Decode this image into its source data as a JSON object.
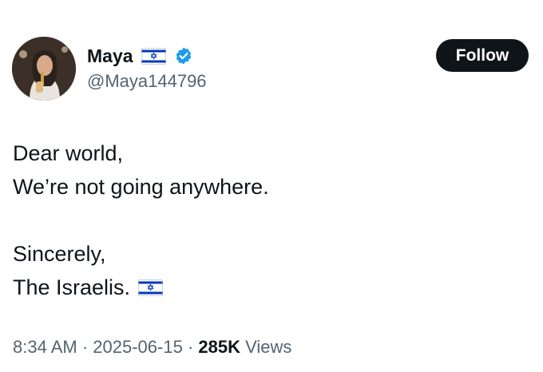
{
  "author": {
    "display_name": "Maya",
    "handle": "@Maya144796",
    "flag_icon": "israel-flag-icon",
    "verified_icon": "verified-badge-icon",
    "verified_color": "#1d9bf0"
  },
  "follow_button": {
    "label": "Follow"
  },
  "tweet": {
    "lines": [
      "Dear world,",
      "We’re not going anywhere.",
      "",
      "Sincerely,",
      "The Israelis."
    ],
    "trailing_icon": "israel-flag-icon"
  },
  "meta": {
    "time": "8:34 AM",
    "sep1": " · ",
    "date": "2025-06-15",
    "sep2": " · ",
    "views_count": "285K",
    "views_label": " Views"
  },
  "colors": {
    "text": "#0f1419",
    "secondary": "#536471",
    "button_bg": "#0f1419",
    "flag_blue": "#0038b8"
  }
}
